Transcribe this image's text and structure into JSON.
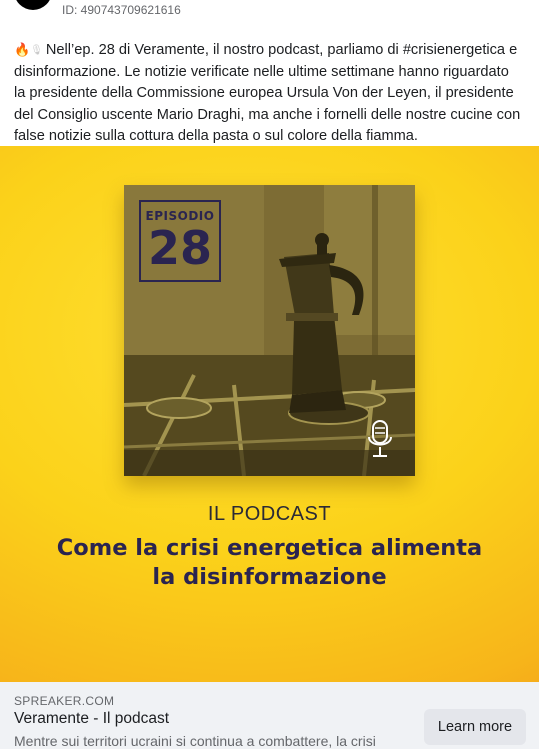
{
  "header": {
    "ad_id": "ID: 490743709621616"
  },
  "post": {
    "emoji_1": "🔥",
    "emoji_2": "🎙",
    "text": "Nell’ep. 28 di Veramente, il nostro podcast, parliamo di #crisienergetica e disinformazione. Le notizie verificate nelle ultime settimane hanno riguardato la presidente della Commissione europea Ursula Von der Leyen, il presidente del Consiglio uscente Mario Draghi, ma anche i fornelli delle nostre cucine con false notizie sulla cottura della pasta o sul colore della fiamma."
  },
  "creative": {
    "episode_label": "EPISODIO",
    "episode_number": "28",
    "podcast_label": "IL PODCAST",
    "headline_line_1": "Come la crisi energetica alimenta",
    "headline_line_2": "la disinformazione",
    "icons": [
      "microphone-icon",
      "moka-pot-illustration"
    ],
    "colors": {
      "background_yellow": "#fbd21a",
      "background_orange": "#f39a1d",
      "headline_navy": "#2a2450"
    }
  },
  "link_preview": {
    "domain": "SPREAKER.COM",
    "title": "Veramente - Il podcast",
    "description": "Mentre sui territori ucraini si continua a combattere, la crisi",
    "cta_label": "Learn more"
  }
}
